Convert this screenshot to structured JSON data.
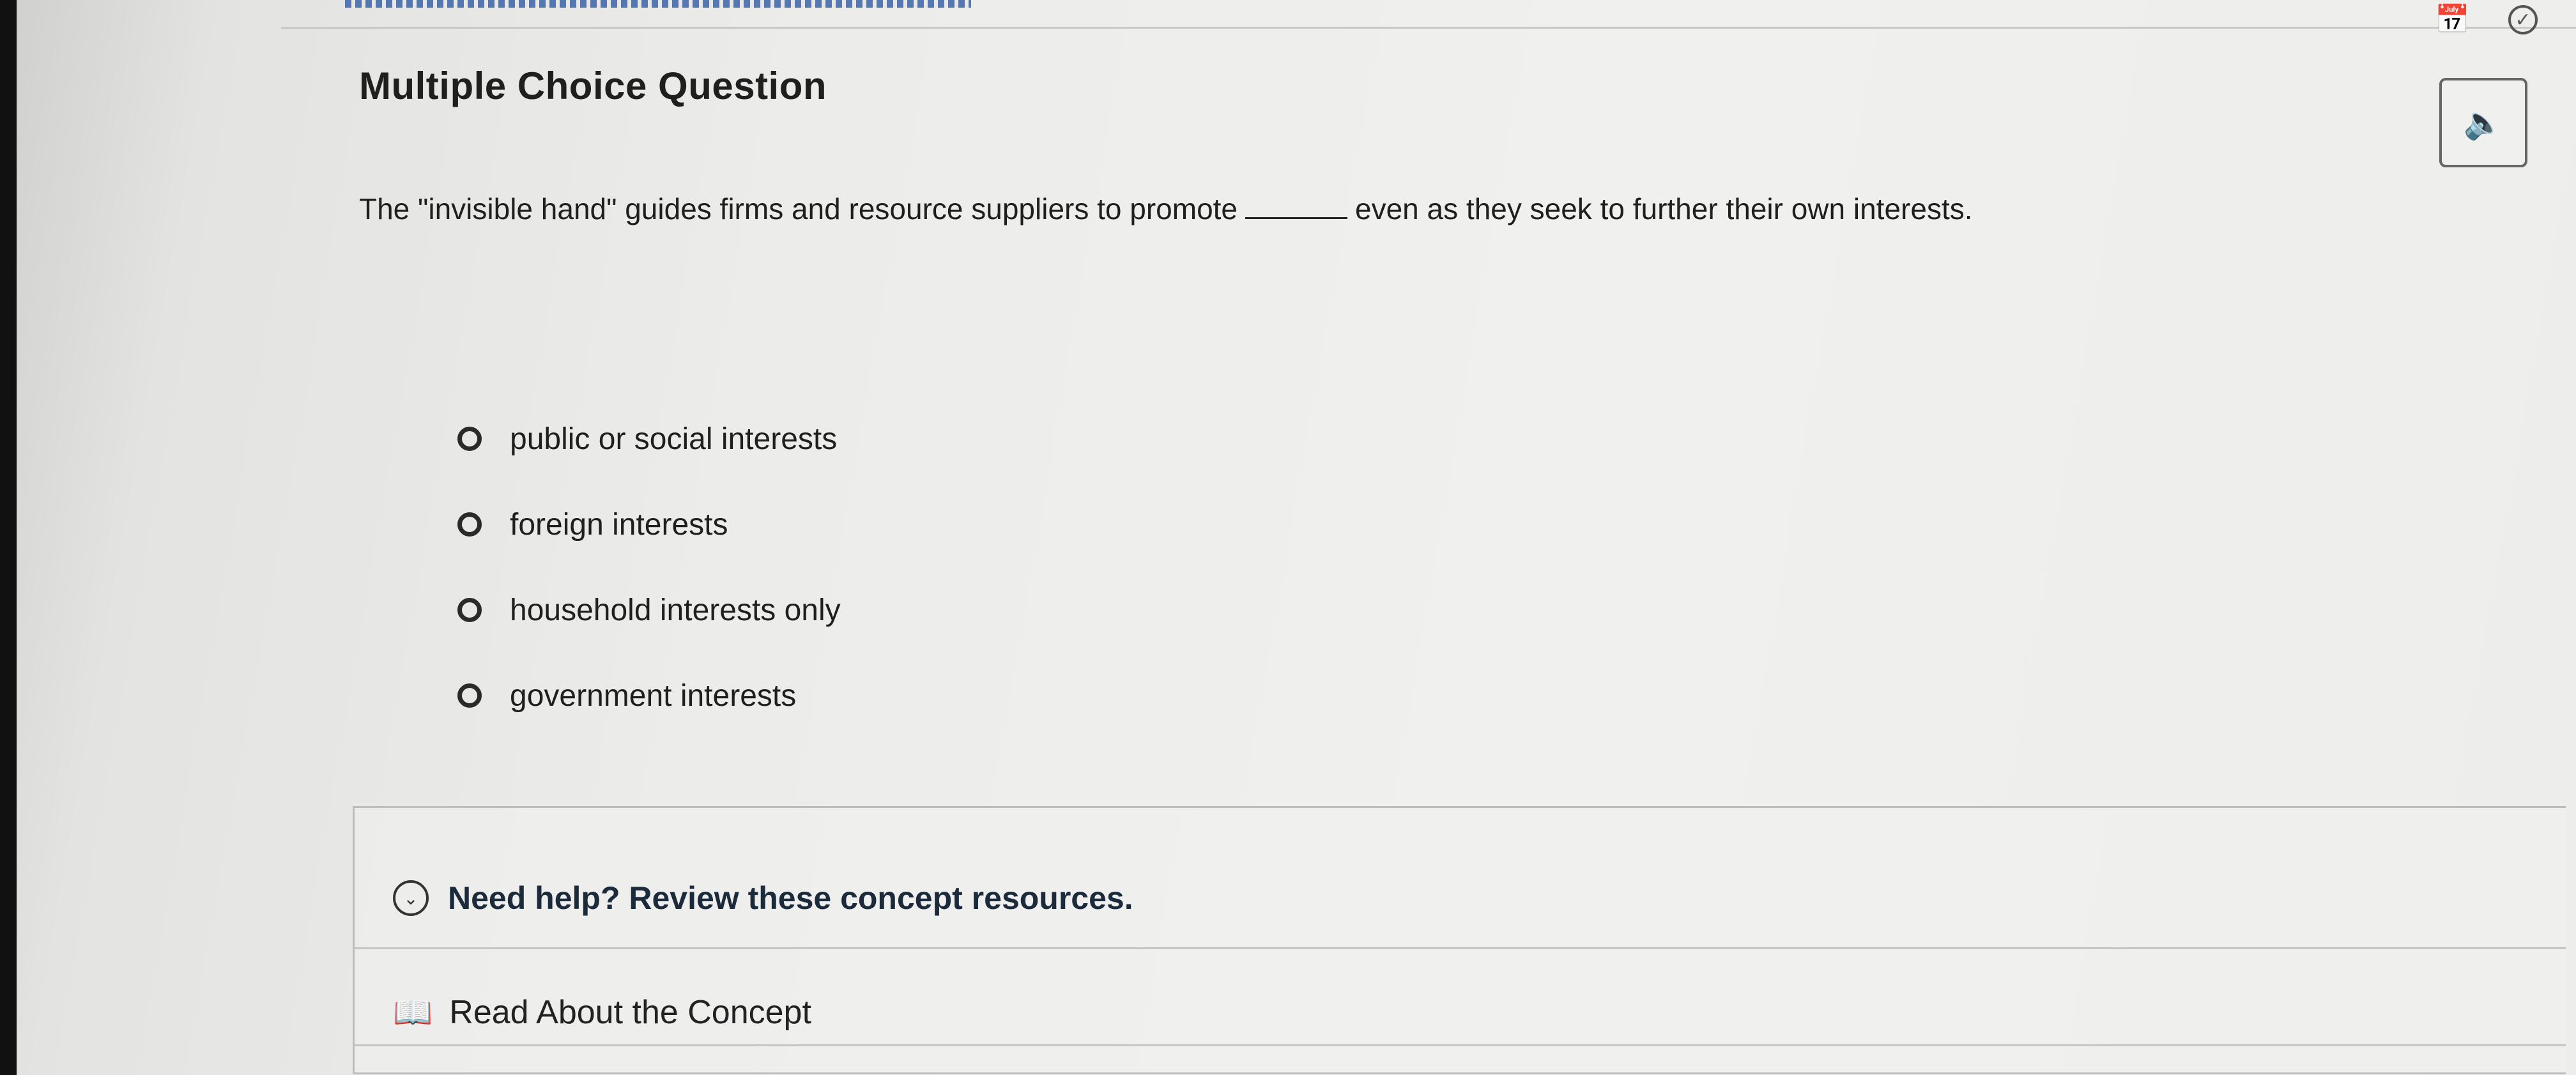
{
  "title": "Multiple Choice Question",
  "question": {
    "before_blank": "The \"invisible hand\" guides firms and resource suppliers to promote",
    "after_blank": "even as they seek to further their own interests."
  },
  "options": [
    {
      "label": "public or social interests"
    },
    {
      "label": "foreign interests"
    },
    {
      "label": "household interests only"
    },
    {
      "label": "government interests"
    }
  ],
  "help": {
    "header": "Need help? Review these concept resources.",
    "resource_label": "Read About the Concept"
  },
  "icons": {
    "audio": "speaker-icon",
    "calendar": "calendar-icon",
    "check": "check-circle-icon",
    "chevron": "chevron-down-circle-icon",
    "book": "book-icon"
  }
}
